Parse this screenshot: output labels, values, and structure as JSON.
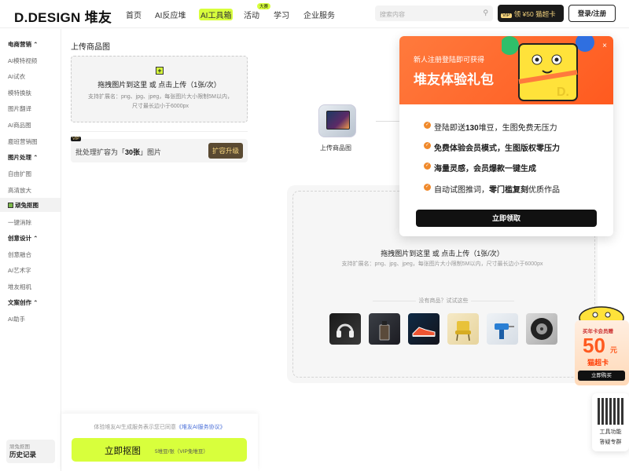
{
  "topbar": {
    "logo": "D.DESIGN 堆友",
    "nav": [
      {
        "label": "首页"
      },
      {
        "label": "AI反应堆"
      },
      {
        "label": "AI工具箱",
        "active": true
      },
      {
        "label": "活动",
        "badge": "大赛"
      },
      {
        "label": "学习"
      },
      {
        "label": "企业服务"
      }
    ],
    "search_placeholder": "搜索内容",
    "vip_tag": "VIP",
    "vip_text": "领 ¥50 猫超卡",
    "login": "登录/注册"
  },
  "sidebar": {
    "sections": [
      {
        "title": "电商营销",
        "items": [
          "AI模特视频",
          "AI试衣",
          "模特换肤",
          "图片翻译",
          "AI商品图",
          "鹿班营销图"
        ]
      },
      {
        "title": "图片处理",
        "items": [
          "自由扩图",
          "高清放大",
          "顽兔抠图",
          "一键消除"
        ]
      },
      {
        "title": "创意设计",
        "items": [
          "创意融合",
          "AI艺术字",
          "堆友相机"
        ]
      },
      {
        "title": "文案创作",
        "items": [
          "AI助手"
        ]
      }
    ],
    "active_item": "顽兔抠图",
    "history_sub": "顽兔抠图",
    "history_main": "历史记录"
  },
  "left_panel": {
    "title": "上传商品图",
    "upload_main": "拖拽图片到这里 或 点击上传（1张/次）",
    "upload_hint": "支持扩展名：png、jpg、jpeg，每张图片大小限制5M以内，尺寸最长边小于6000px",
    "batch_vip": "VIP",
    "batch_prefix": "批处理扩容为「",
    "batch_count": "30张",
    "batch_suffix": "」图片",
    "batch_button": "扩容升级",
    "agree_prefix": "体验堆友AI生成服务表示您已同意",
    "agree_link": "《堆友AI服务协议》",
    "start_button": "立即抠图",
    "start_cost": "5堆豆/张（VIP免堆豆）"
  },
  "main": {
    "flow_step_label": "上传商品图",
    "upload_main": "拖拽图片到这里 或 点击上传（1张/次）",
    "upload_hint": "支持扩展名：png、jpg、jpeg，每张图片大小限制5M以内，尺寸最长边小于6000px",
    "try_label": "没有商品？试试这些",
    "samples": [
      "headphones",
      "perfume",
      "sneaker",
      "chair",
      "drill",
      "tire"
    ]
  },
  "popup": {
    "subtitle": "新人注册登陆即可获得",
    "title": "堆友体验礼包",
    "close": "×",
    "perks": [
      {
        "prefix": "登陆即送",
        "bold": "130",
        "suffix": "堆豆，生图免费无压力"
      },
      {
        "prefix": "",
        "bold": "免费体验会员模式，生图版权零压力",
        "suffix": ""
      },
      {
        "prefix": "",
        "bold": "海量灵感，会员爆款一键生成",
        "suffix": ""
      },
      {
        "prefix": "自动试图推词，",
        "bold": "零门槛复刻",
        "suffix": "优质作品"
      }
    ],
    "claim": "立即领取"
  },
  "floaters": {
    "promo_top": "买年卡会员赠",
    "promo_amount": "50",
    "promo_unit": "元",
    "promo_name": "猫超卡",
    "promo_button": "立即购买",
    "qr_line1": "工具功能",
    "qr_line2": "答疑专群"
  }
}
